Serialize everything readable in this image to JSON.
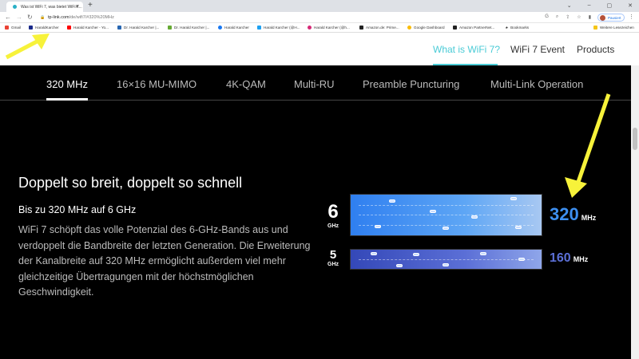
{
  "browser": {
    "tab_title": "Was ist WiFi 7, was bietet WiFi 7...",
    "url_domain": "tp-link.com",
    "url_path": "/de/wifi7/#320%20MHz",
    "profile_label": "Pausiert",
    "bookmarks": [
      "Gmail",
      "HaraldKarcher",
      "Harald Karcher - Yo...",
      "Dr. Harald Karcher |...",
      "Dr. Harald Karcher |...",
      "Harald Karcher",
      "Harald Karcher (@H...",
      "Harald Karcher (@h...",
      "Amazon.de: Prime...",
      "Google Dashboard",
      "Amazon PartnerNet...",
      "Bookmarks"
    ],
    "other_bookmarks": "Weitere Lesezeichen"
  },
  "site_nav": [
    "What is WiFi 7?",
    "WiFi 7 Event",
    "Products"
  ],
  "subtabs": [
    "320 MHz",
    "16×16 MU-MIMO",
    "4K-QAM",
    "Multi-RU",
    "Preamble Puncturing",
    "Multi-Link Operation"
  ],
  "content": {
    "heading": "Doppelt so breit, doppelt so schnell",
    "subheading": "Bis zu 320 MHz auf 6 GHz",
    "body": "WiFi 7 schöpft das volle Potenzial des 6-GHz-Bands aus und verdoppelt die Bandbreite der letzten Generation. Die Erweiterung der Kanalbreite auf 320 MHz ermöglicht außerdem viel mehr gleichzeitige Übertragungen mit der höchstmöglichen Geschwindigkeit."
  },
  "bands": [
    {
      "num": "6",
      "unit": "GHz",
      "width": "320",
      "width_unit": "MHz",
      "color": "#3d8ff0"
    },
    {
      "num": "5",
      "unit": "GHz",
      "width": "160",
      "width_unit": "MHz",
      "color": "#5b6fd6"
    }
  ],
  "annotation_color": "#f7f23a"
}
